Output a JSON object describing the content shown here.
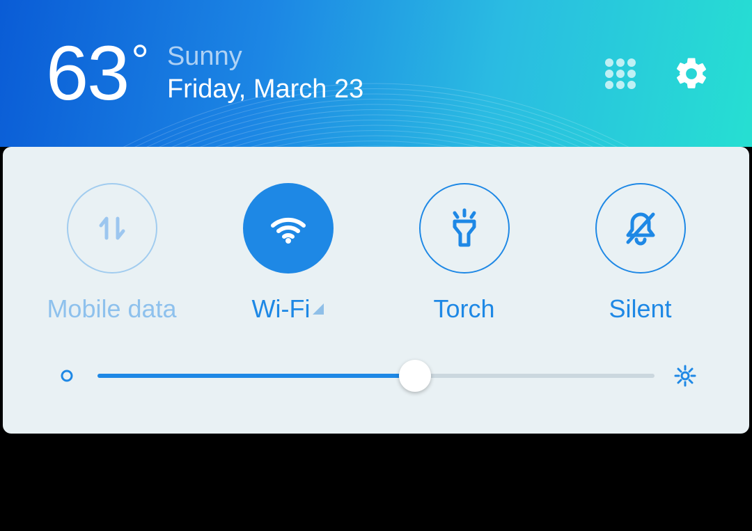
{
  "header": {
    "temperature": "63",
    "degree_symbol": "°",
    "condition": "Sunny",
    "date": "Friday, March 23"
  },
  "toggles": {
    "items": [
      {
        "label": "Mobile data",
        "active": false,
        "disabled": true
      },
      {
        "label": "Wi-Fi",
        "active": true,
        "disabled": false,
        "has_caret": true
      },
      {
        "label": "Torch",
        "active": false,
        "disabled": false
      },
      {
        "label": "Silent",
        "active": false,
        "disabled": false
      }
    ]
  },
  "brightness": {
    "value_percent": 57
  },
  "colors": {
    "accent": "#1e88e5",
    "panel_bg": "#e9f1f4"
  }
}
